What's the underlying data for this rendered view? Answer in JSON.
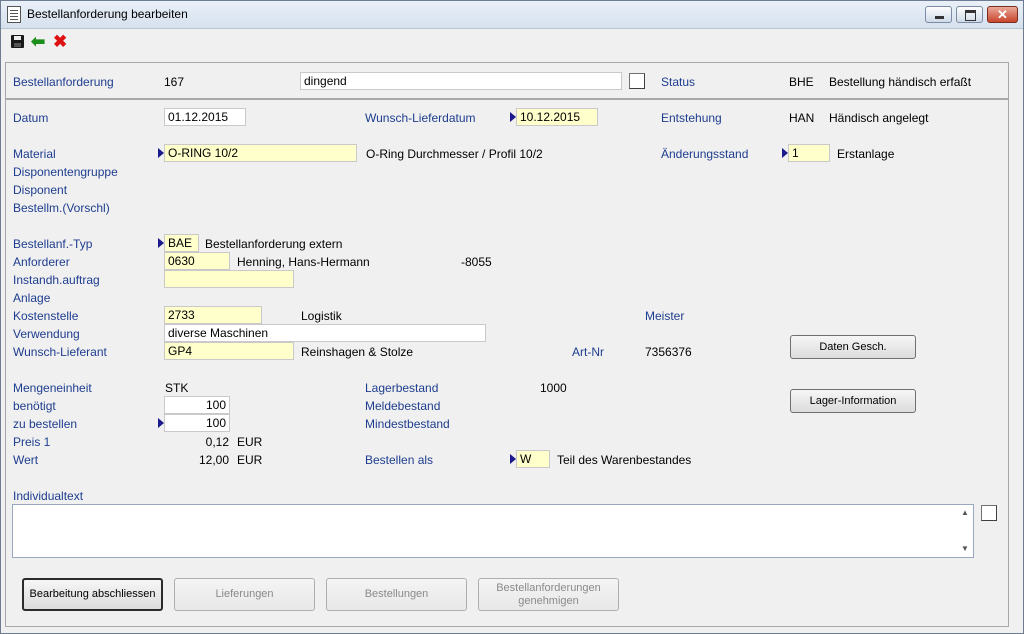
{
  "window": {
    "title": "Bestellanforderung bearbeiten"
  },
  "toolbar": {
    "save_icon": "save-icon",
    "back_icon": "back-arrow-icon",
    "cancel_icon": "cancel-icon"
  },
  "header": {
    "bestellanforderung_label": "Bestellanforderung",
    "bestellanforderung_value": "167",
    "text_field": "dingend",
    "status_label": "Status",
    "status_code": "BHE",
    "status_text": "Bestellung händisch erfaßt"
  },
  "form": {
    "datum_label": "Datum",
    "datum_value": "01.12.2015",
    "wunsch_lieferdatum_label": "Wunsch-Lieferdatum",
    "wunsch_lieferdatum_value": "10.12.2015",
    "entstehung_label": "Entstehung",
    "entstehung_code": "HAN",
    "entstehung_text": "Händisch angelegt",
    "material_label": "Material",
    "material_value": "O-RING 10/2",
    "material_desc": "O-Ring Durchmesser / Profil 10/2",
    "aenderungsstand_label": "Änderungsstand",
    "aenderungsstand_value": "1",
    "aenderungsstand_text": "Erstanlage",
    "disponentengruppe_label": "Disponentengruppe",
    "disponent_label": "Disponent",
    "bestellm_label": "Bestellm.(Vorschl)",
    "typ_label": "Bestellanf.-Typ",
    "typ_value": "BAE",
    "typ_text": "Bestellanforderung extern",
    "anforderer_label": "Anforderer",
    "anforderer_value": "0630",
    "anforderer_name": "Henning, Hans-Hermann",
    "anforderer_phone": "-8055",
    "instandh_label": "Instandh.auftrag",
    "instandh_value": "",
    "anlage_label": "Anlage",
    "kostenstelle_label": "Kostenstelle",
    "kostenstelle_value": "2733",
    "kostenstelle_text": "Logistik",
    "meister_label": "Meister",
    "verwendung_label": "Verwendung",
    "verwendung_value": "diverse Maschinen",
    "lieferant_label": "Wunsch-Lieferant",
    "lieferant_value": "GP4",
    "lieferant_name": "Reinshagen & Stolze",
    "artnr_label": "Art-Nr",
    "artnr_value": "7356376",
    "mengeneinheit_label": "Mengeneinheit",
    "mengeneinheit_value": "STK",
    "lagerbestand_label": "Lagerbestand",
    "lagerbestand_value": "1000",
    "benoetigt_label": "benötigt",
    "benoetigt_value": "100",
    "meldebestand_label": "Meldebestand",
    "zu_bestellen_label": "zu bestellen",
    "zu_bestellen_value": "100",
    "mindestbestand_label": "Mindestbestand",
    "preis_label": "Preis 1",
    "preis_value": "0,12",
    "preis_currency": "EUR",
    "wert_label": "Wert",
    "wert_value": "12,00",
    "wert_currency": "EUR",
    "bestellen_als_label": "Bestellen als",
    "bestellen_als_value": "W",
    "bestellen_als_text": "Teil des Warenbestandes",
    "individualtext_label": "Individualtext",
    "individualtext_value": ""
  },
  "side_buttons": {
    "daten_gesch": "Daten Gesch.",
    "lager_information": "Lager-Information"
  },
  "bottom_buttons": {
    "abschliessen": "Bearbeitung abschliessen",
    "lieferungen": "Lieferungen",
    "bestellungen": "Bestellungen",
    "genehmigen_line1": "Bestellanforderungen",
    "genehmigen_line2": "genehmigen"
  }
}
